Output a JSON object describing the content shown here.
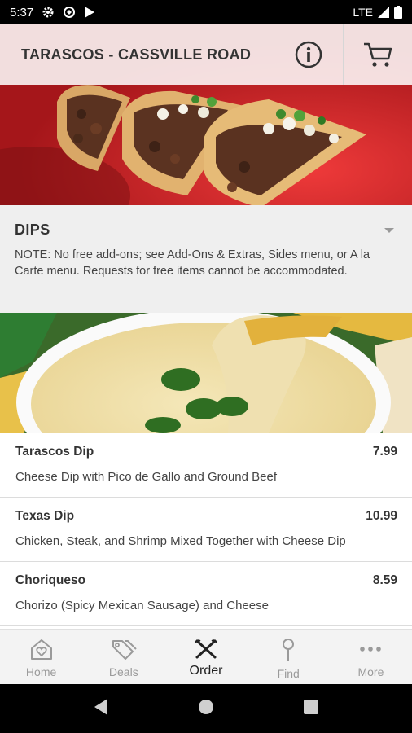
{
  "status_bar": {
    "time": "5:37",
    "network": "LTE"
  },
  "header": {
    "restaurant_name": "TARASCOS - CASSVILLE ROAD"
  },
  "category": {
    "title": "DIPS",
    "note": "NOTE: No free add-ons; see Add-Ons & Extras, Sides menu, or A la Carte menu. Requests for free items cannot be accommodated."
  },
  "menu_items": [
    {
      "name": "Tarascos Dip",
      "price": "7.99",
      "description": "Cheese Dip with Pico de Gallo and Ground Beef"
    },
    {
      "name": "Texas Dip",
      "price": "10.99",
      "description": "Chicken, Steak, and Shrimp Mixed Together with Cheese Dip"
    },
    {
      "name": "Choriqueso",
      "price": "8.59",
      "description": "Chorizo (Spicy Mexican Sausage) and Cheese"
    }
  ],
  "bottom_nav": [
    {
      "label": "Home",
      "icon": "home-heart-icon"
    },
    {
      "label": "Deals",
      "icon": "tags-icon"
    },
    {
      "label": "Order",
      "icon": "utensils-icon"
    },
    {
      "label": "Find",
      "icon": "map-pin-icon"
    },
    {
      "label": "More",
      "icon": "more-dots-icon"
    }
  ],
  "colors": {
    "header_bg": "#ffffff",
    "category_bg": "#efefef",
    "plate_red": "#c51d22",
    "nav_active": "#222222",
    "nav_inactive": "#9a9a9a"
  }
}
